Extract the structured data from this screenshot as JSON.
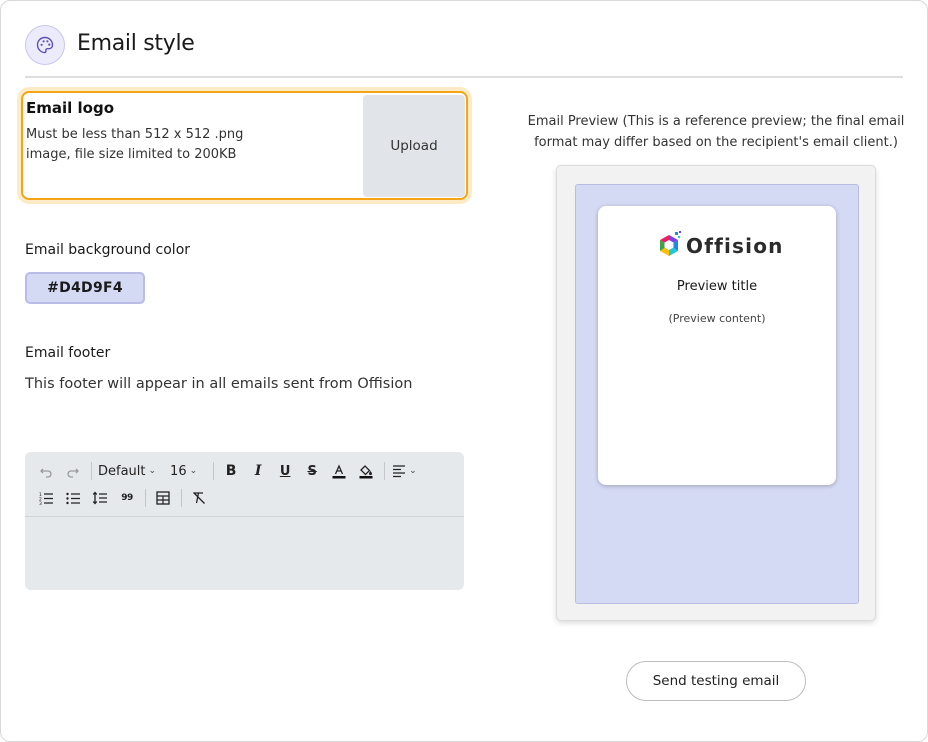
{
  "header": {
    "title": "Email style",
    "icon": "palette-icon"
  },
  "email_logo": {
    "title": "Email logo",
    "description": "Must be less than 512 x 512 .png image, file size limited to 200KB",
    "upload_label": "Upload"
  },
  "background_color": {
    "label": "Email background color",
    "value": "#D4D9F4"
  },
  "footer": {
    "label": "Email footer",
    "description": "This footer will appear in all emails sent from Offision"
  },
  "editor": {
    "font_family": "Default",
    "font_size": "16",
    "quote_glyph": "99",
    "toolbar_icons": [
      "undo-icon",
      "redo-icon",
      "bold-icon",
      "italic-icon",
      "underline-icon",
      "strikethrough-icon",
      "font-color-icon",
      "highlight-icon",
      "align-icon",
      "ordered-list-icon",
      "bullet-list-icon",
      "line-height-icon",
      "quote-icon",
      "table-icon",
      "clear-format-icon"
    ]
  },
  "preview": {
    "caption": "Email Preview (This is a reference preview; the final email format may differ based on the recipient's email client.)",
    "brand": "Offision",
    "title": "Preview title",
    "content": "(Preview content)",
    "background_color": "#D4D9F4"
  },
  "actions": {
    "send_test_label": "Send testing email"
  },
  "colors": {
    "accent_orange": "#F5A415",
    "accent_purple": "#7B6FD6",
    "editor_bg": "#E6E9EC"
  }
}
